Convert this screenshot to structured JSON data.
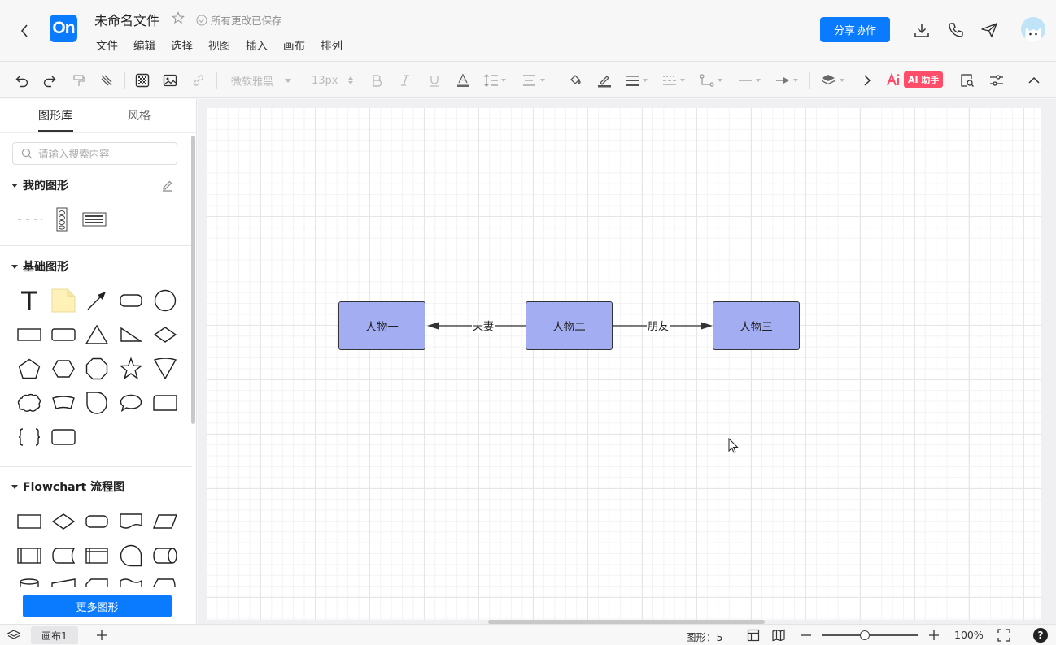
{
  "header": {
    "logo_text": "On",
    "file_title": "未命名文件",
    "save_status": "所有更改已保存",
    "menus": [
      "文件",
      "编辑",
      "选择",
      "视图",
      "插入",
      "画布",
      "排列"
    ],
    "share_label": "分享协作"
  },
  "toolbar": {
    "font_family": "微软雅黑",
    "font_size": "13px",
    "ai_label": "AI 助手"
  },
  "sidebar": {
    "tabs": [
      "图形库",
      "风格"
    ],
    "search_placeholder": "请输入搜索内容",
    "sections": {
      "my_shapes": "我的图形",
      "basic_shapes": "基础图形",
      "flowchart": "Flowchart 流程图"
    },
    "more_button": "更多图形"
  },
  "diagram": {
    "nodes": [
      "人物一",
      "人物二",
      "人物三"
    ],
    "edges": [
      {
        "from": "人物二",
        "to": "人物一",
        "label": "夫妻"
      },
      {
        "from": "人物二",
        "to": "人物三",
        "label": "朋友"
      }
    ],
    "node_fill": "#a3adf2"
  },
  "status": {
    "page_tab": "画布1",
    "shape_count": "图形：5",
    "zoom": "100%",
    "help": "?"
  },
  "colors": {
    "accent": "#0a7aff",
    "ai_badge": "#ff4d6a"
  }
}
